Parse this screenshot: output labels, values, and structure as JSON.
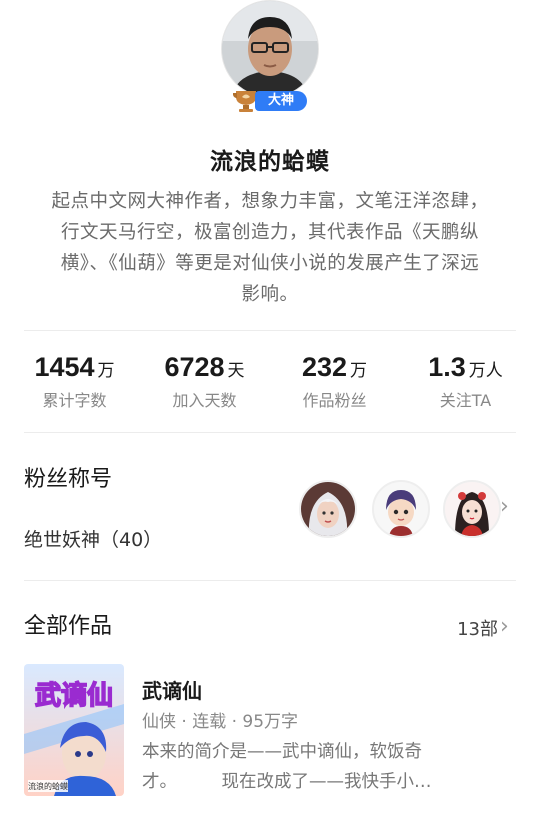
{
  "author": {
    "name": "流浪的蛤蟆",
    "badge_label": "大神",
    "bio": "起点中文网大神作者，想象力丰富，文笔汪洋恣肆，行文天马行空，极富创造力，其代表作品《天鹏纵横》、《仙葫》等更是对仙侠小说的发展产生了深远影响。",
    "bio_lines": [
      "起点中文网大神作者，想象力丰富，文笔汪洋恣肆，",
      "行文天马行空，极富创造力，其代表作品《天鹏纵",
      "横》、《仙葫》等更是对仙侠小说的发展产生了深远",
      "影响。"
    ]
  },
  "stats": [
    {
      "value": "1454",
      "unit": "万",
      "label": "累计字数"
    },
    {
      "value": "6728",
      "unit": "天",
      "label": "加入天数"
    },
    {
      "value": "232",
      "unit": "万",
      "label": "作品粉丝"
    },
    {
      "value": "1.3",
      "unit": "万人",
      "label": "关注TA"
    }
  ],
  "fan_title": {
    "label": "粉丝称号",
    "value": "绝世妖神（40）",
    "avatar_icons": [
      "fan-avatar-silver-hair-icon",
      "fan-avatar-boy-icon",
      "fan-avatar-girl-icon"
    ]
  },
  "works": {
    "label": "全部作品",
    "count": "13部",
    "items": [
      {
        "title": "武谪仙",
        "meta": "仙侠 · 连载 · 95万字",
        "desc_lines": [
          "本来的简介是——武中谪仙，软饭奇",
          "才。        现在改成了——我快手小…"
        ],
        "cover_title": "武谪仙",
        "cover_author": "流浪的蛤蟆"
      }
    ]
  },
  "colors": {
    "accent": "#2f7cf6",
    "badge_cup": "#c9823a",
    "text_primary": "#1a1a1a",
    "text_secondary": "#888888"
  }
}
